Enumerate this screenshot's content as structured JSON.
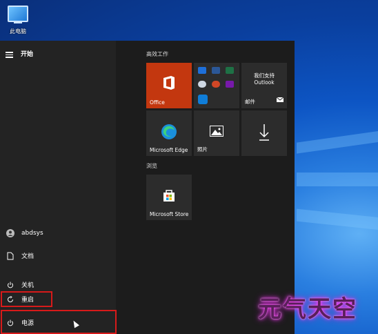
{
  "desktop": {
    "icon_label": "此电脑"
  },
  "start_menu": {
    "title": "开始",
    "left_rail": {
      "user": "abdsys",
      "documents": "文档",
      "shutdown": "关机",
      "restart": "重启",
      "power": "电源"
    },
    "groups": [
      {
        "title": "高效工作",
        "tiles": [
          {
            "label": "Office",
            "icon": "office-icon"
          },
          {
            "label": "",
            "icon": "office-apps-icon"
          },
          {
            "label": "邮件",
            "lines": [
              "我们支持",
              "Outlook"
            ],
            "icon": "mail-icon"
          },
          {
            "label": "Microsoft Edge",
            "icon": "edge-icon"
          },
          {
            "label": "照片",
            "icon": "photos-icon"
          },
          {
            "label": "",
            "icon": "download-icon"
          }
        ]
      },
      {
        "title": "浏览",
        "tiles": [
          {
            "label": "Microsoft Store",
            "icon": "store-icon"
          }
        ]
      }
    ]
  },
  "watermark": "元气天空",
  "colors": {
    "office_tile": "#c3370f",
    "highlight_box": "#d81a1a",
    "menu_bg": "#1f1f1f"
  }
}
